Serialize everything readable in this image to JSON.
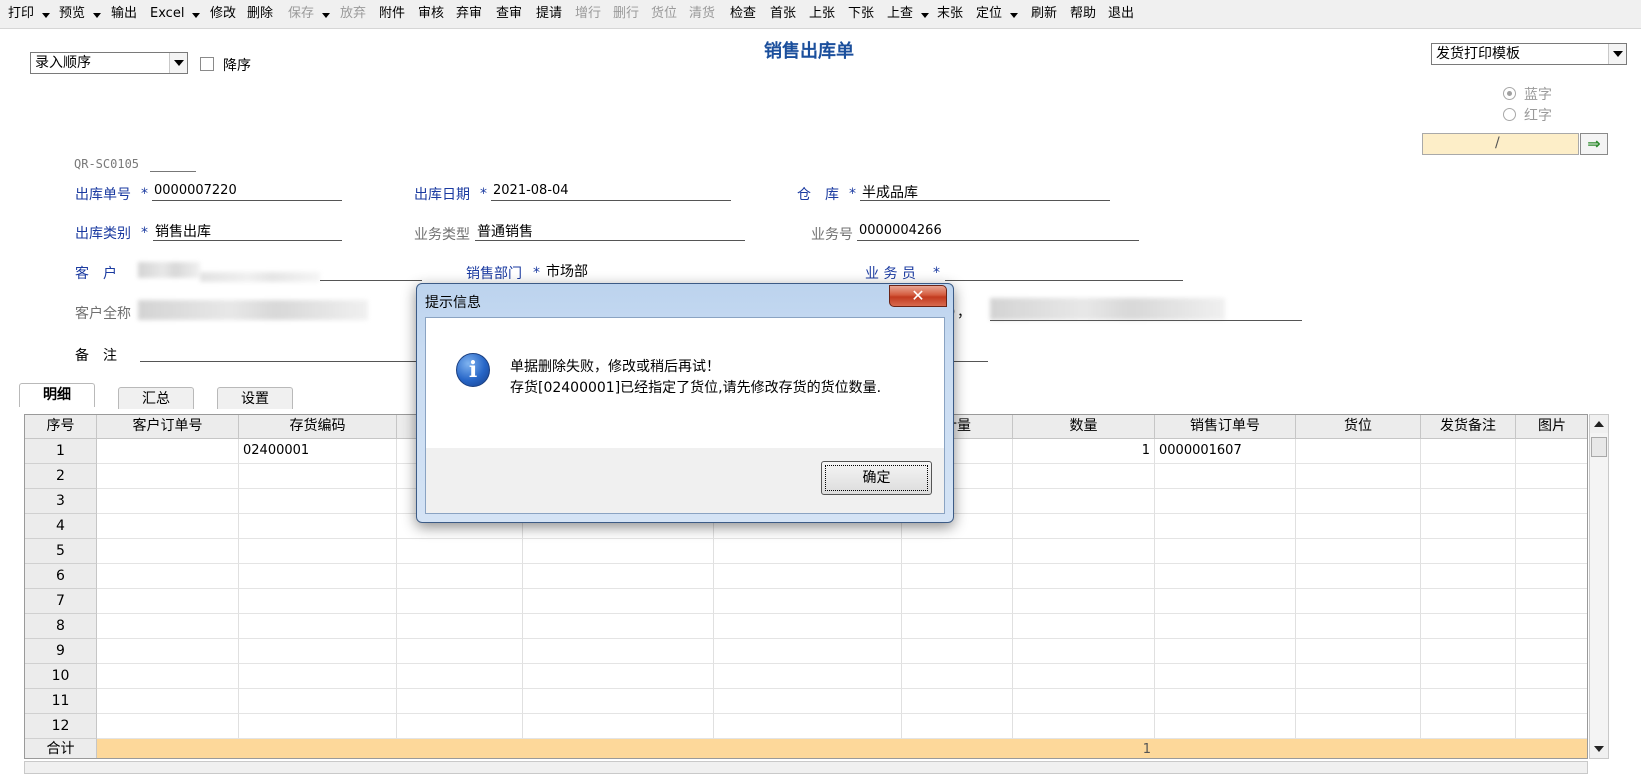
{
  "toolbar": {
    "items": [
      {
        "label": "打印",
        "disabled": false,
        "dropdown": true
      },
      {
        "label": "预览",
        "disabled": false,
        "dropdown": true
      },
      {
        "label": "输出",
        "disabled": false,
        "dropdown": false
      },
      {
        "label": "Excel",
        "disabled": false,
        "dropdown": true
      },
      {
        "label": "修改",
        "disabled": false,
        "dropdown": false
      },
      {
        "label": "删除",
        "disabled": false,
        "dropdown": false
      },
      {
        "label": "保存",
        "disabled": true,
        "dropdown": true
      },
      {
        "label": "放弃",
        "disabled": true,
        "dropdown": false
      },
      {
        "label": "附件",
        "disabled": false,
        "dropdown": false
      },
      {
        "label": "审核",
        "disabled": false,
        "dropdown": false
      },
      {
        "label": "弃审",
        "disabled": false,
        "dropdown": false
      },
      {
        "label": "查审",
        "disabled": false,
        "dropdown": false
      },
      {
        "label": "提请",
        "disabled": false,
        "dropdown": false
      },
      {
        "label": "增行",
        "disabled": true,
        "dropdown": false
      },
      {
        "label": "删行",
        "disabled": true,
        "dropdown": false
      },
      {
        "label": "货位",
        "disabled": true,
        "dropdown": false
      },
      {
        "label": "清货",
        "disabled": true,
        "dropdown": false
      },
      {
        "label": "检查",
        "disabled": false,
        "dropdown": false
      },
      {
        "label": "首张",
        "disabled": false,
        "dropdown": false
      },
      {
        "label": "上张",
        "disabled": false,
        "dropdown": false
      },
      {
        "label": "下张",
        "disabled": false,
        "dropdown": false
      },
      {
        "label": "上查",
        "disabled": false,
        "dropdown": true
      },
      {
        "label": "末张",
        "disabled": false,
        "dropdown": false
      },
      {
        "label": "定位",
        "disabled": false,
        "dropdown": true
      },
      {
        "label": "刷新",
        "disabled": false,
        "dropdown": false
      },
      {
        "label": "帮助",
        "disabled": false,
        "dropdown": false
      },
      {
        "label": "退出",
        "disabled": false,
        "dropdown": false
      }
    ]
  },
  "page": {
    "title": "销售出库单",
    "sort_select": "录入顺序",
    "desc_label": "降序",
    "template_select": "发货打印模板",
    "radio_blue": "蓝字",
    "radio_red": "红字",
    "date_field": "/",
    "go_arrow": "⇒"
  },
  "form": {
    "code": "QR-SC0105",
    "out_no_label": "出库单号",
    "out_no": "0000007220",
    "out_date_label": "出库日期",
    "out_date": "2021-08-04",
    "warehouse_label": "仓　库",
    "warehouse": "半成品库",
    "out_type_label": "出库类别",
    "out_type": "销售出库",
    "biz_type_label": "业务类型",
    "biz_type": "普通销售",
    "biz_no_label": "业务号",
    "biz_no": "0000004266",
    "customer_label": "客　户",
    "dept_label": "销售部门",
    "dept": "市场部",
    "salesman_label": "业 务 员",
    "customer_full_label": "客户全称",
    "remark_label": "备　注",
    "asterisk": "*",
    "paren_frag": "），"
  },
  "tabs": [
    "明细",
    "汇总",
    "设置"
  ],
  "grid": {
    "columns": [
      "序号",
      "客户订单号",
      "存货编码",
      "",
      "",
      "",
      "计量",
      "数量",
      "销售订单号",
      "货位",
      "发货备注",
      "图片"
    ],
    "rows": [
      {
        "no": "1",
        "inv_code": "02400001",
        "qty": "1",
        "so_no": "0000001607"
      },
      {
        "no": "2"
      },
      {
        "no": "3"
      },
      {
        "no": "4"
      },
      {
        "no": "5"
      },
      {
        "no": "6"
      },
      {
        "no": "7"
      },
      {
        "no": "8"
      },
      {
        "no": "9"
      },
      {
        "no": "10"
      },
      {
        "no": "11"
      },
      {
        "no": "12"
      }
    ],
    "total_label": "合计",
    "total_qty": "1"
  },
  "dialog": {
    "title": "提示信息",
    "close": "✕",
    "icon": "i",
    "line1": "单据删除失败，修改或稍后再试！",
    "line2": "存货[02400001]已经指定了货位,请先修改存货的货位数量.",
    "ok": "确定"
  }
}
